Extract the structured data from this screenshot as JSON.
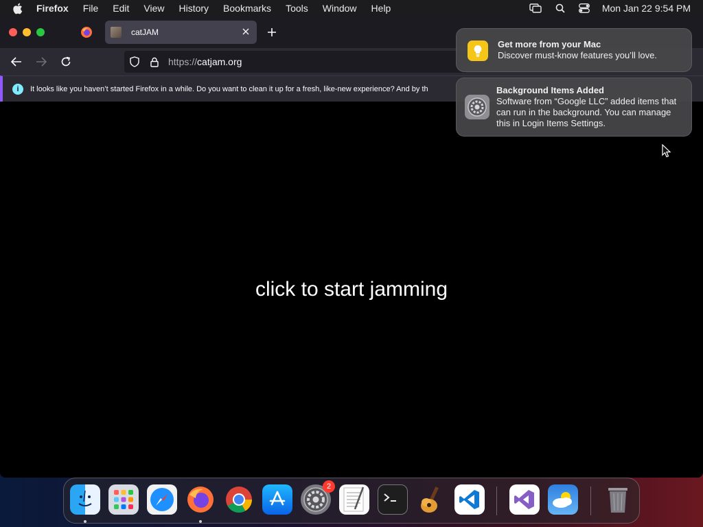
{
  "menubar": {
    "app_name": "Firefox",
    "items": [
      "File",
      "Edit",
      "View",
      "History",
      "Bookmarks",
      "Tools",
      "Window",
      "Help"
    ],
    "clock": "Mon Jan 22  9:54 PM"
  },
  "browser": {
    "tab": {
      "title": "catJAM"
    },
    "url": {
      "scheme": "https://",
      "host": "catjam.org"
    },
    "infobar": {
      "message": "It looks like you haven’t started Firefox in a while. Do you want to clean it up for a fresh, like-new experience? And by th"
    }
  },
  "page": {
    "cta": "click to start jamming"
  },
  "notifications": [
    {
      "title": "Get more from your Mac",
      "body": "Discover must-know features you’ll love.",
      "icon": "lightbulb-icon"
    },
    {
      "title": "Background Items Added",
      "body": "Software from “Google LLC” added items that can run in the background. You can manage this in Login Items Settings.",
      "icon": "gear-icon"
    }
  ],
  "dock": {
    "items": [
      "Finder",
      "Launchpad",
      "Safari",
      "Firefox",
      "Chrome",
      "App Store",
      "System Settings",
      "TextEdit",
      "Terminal",
      "GarageBand",
      "Visual Studio Code",
      "Visual Studio",
      "Weather",
      "Trash"
    ],
    "settings_badge": "2"
  },
  "colors": {
    "accent": "#9059ff",
    "info": "#80ebff",
    "badge": "#ff3b30"
  }
}
